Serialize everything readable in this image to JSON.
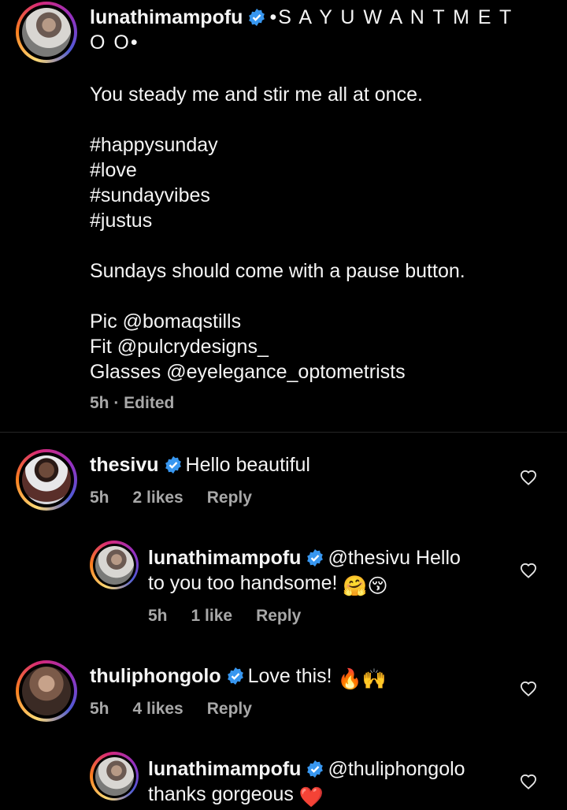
{
  "caption": {
    "username": "lunathimampofu",
    "title_line1": "•S A Y U W A N T M E T",
    "title_line2": "O O•",
    "line1": "You steady me and stir me all at once.",
    "tags": [
      "#happysunday",
      "#love",
      "#sundayvibes",
      "#justus"
    ],
    "line2": "Sundays should come with a pause button.",
    "credits": [
      "Pic @bomaqstills",
      "Fit @pulcrydesigns_",
      "Glasses @eyelegance_optometrists"
    ],
    "meta": "5h · Edited"
  },
  "comments": [
    {
      "username": "thesivu",
      "text": "Hello beautiful",
      "time": "5h",
      "likes": "2 likes",
      "reply": "Reply"
    },
    {
      "username": "lunathimampofu",
      "text_line1": "@thesivu Hello",
      "text_line2": "to you too handsome!",
      "emoji": "🤗😚",
      "time": "5h",
      "likes": "1 like",
      "reply": "Reply"
    },
    {
      "username": "thuliphongolo",
      "text": "Love this!",
      "emoji": "🔥🙌",
      "time": "5h",
      "likes": "4 likes",
      "reply": "Reply"
    },
    {
      "username": "lunathimampofu",
      "text_line1": "@thuliphongolo",
      "text_line2": "thanks gorgeous",
      "emoji": "❤️"
    }
  ],
  "icons": {
    "verified": "verified-badge-icon",
    "like": "heart-outline-icon",
    "verified_color": "#3897f0"
  }
}
